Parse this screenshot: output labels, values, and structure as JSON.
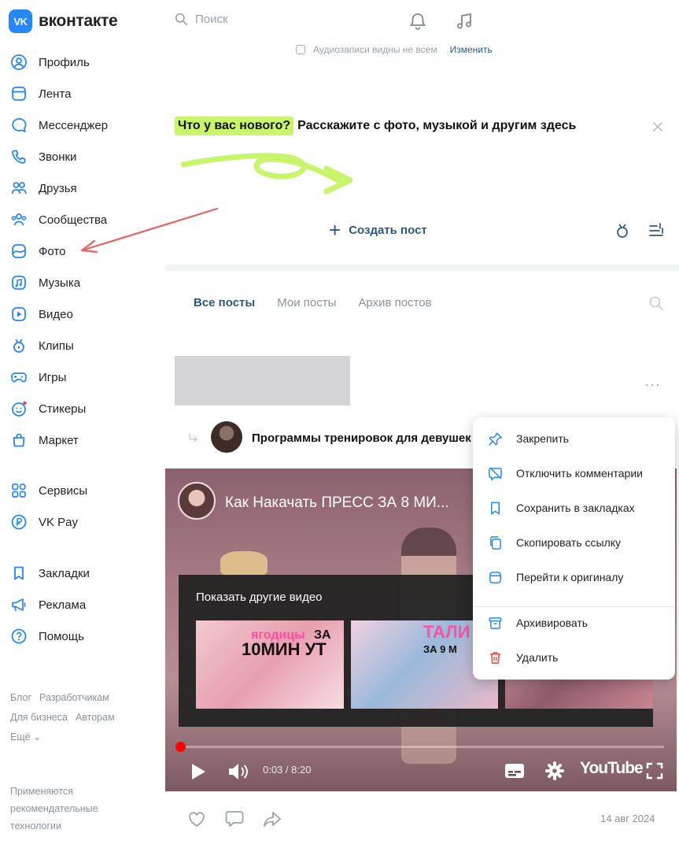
{
  "header": {
    "logo_mark": "VK",
    "logo_text": "вконтакте",
    "search_placeholder": "Поиск",
    "notifications_icon": "bell-icon",
    "music_icon": "music-note-icon"
  },
  "sidebar": {
    "items": [
      {
        "label": "Профиль",
        "icon": "profile-icon"
      },
      {
        "label": "Лента",
        "icon": "feed-icon"
      },
      {
        "label": "Мессенджер",
        "icon": "messenger-icon"
      },
      {
        "label": "Звонки",
        "icon": "phone-icon"
      },
      {
        "label": "Друзья",
        "icon": "friends-icon"
      },
      {
        "label": "Сообщества",
        "icon": "communities-icon"
      },
      {
        "label": "Фото",
        "icon": "photo-icon"
      },
      {
        "label": "Музыка",
        "icon": "music-icon"
      },
      {
        "label": "Видео",
        "icon": "video-icon"
      },
      {
        "label": "Клипы",
        "icon": "clips-icon"
      },
      {
        "label": "Игры",
        "icon": "games-icon"
      },
      {
        "label": "Стикеры",
        "icon": "stickers-icon"
      },
      {
        "label": "Маркет",
        "icon": "market-icon"
      },
      {
        "label": "Сервисы",
        "icon": "services-icon"
      },
      {
        "label": "VK Pay",
        "icon": "vk-pay-icon"
      },
      {
        "label": "Закладки",
        "icon": "bookmarks-icon"
      },
      {
        "label": "Реклама",
        "icon": "ads-icon"
      },
      {
        "label": "Помощь",
        "icon": "help-icon"
      }
    ],
    "footer_links": {
      "row1": [
        "Блог",
        "Разработчикам"
      ],
      "row2": [
        "Для бизнеса",
        "Авторам"
      ],
      "row3": [
        "Ещё ⌄"
      ]
    },
    "footer_note": "Применяются рекомендательные технологии"
  },
  "composer": {
    "hidden_notice": "Аудиозаписи видны не всем",
    "hidden_notice_action": "Изменить",
    "prompt_highlight": "Что у вас нового?",
    "prompt_rest": "Расскажите с фото, музыкой и другим здесь",
    "create_post": "Создать пост"
  },
  "tabs": {
    "all_posts": "Все посты",
    "my_posts": "Мои посты",
    "archive": "Архив постов"
  },
  "post": {
    "title": "Программы тренировок для девушек",
    "date": "14 авг 2024",
    "video": {
      "title": "Как Накачать ПРЕСС ЗА 8 МИ...",
      "overlay_title": "Показать другие видео",
      "thumb1_text_a": "ягодицы",
      "thumb1_text_b": "ЗА",
      "thumb1_text_c": "10МИН УТ",
      "thumb2_text_a": "ТАЛИ",
      "thumb2_text_b": "ЗА 9 М",
      "time": "0:03 / 8:20",
      "progress": 0.006,
      "brand": "YouTube"
    }
  },
  "context_menu": {
    "items": [
      {
        "label": "Закрепить",
        "icon": "pin-icon"
      },
      {
        "label": "Отключить комментарии",
        "icon": "comments-off-icon"
      },
      {
        "label": "Сохранить в закладках",
        "icon": "bookmark-icon"
      },
      {
        "label": "Скопировать ссылку",
        "icon": "copy-link-icon"
      },
      {
        "label": "Перейти к оригиналу",
        "icon": "original-icon"
      },
      {
        "label": "Архивировать",
        "icon": "archive-icon"
      },
      {
        "label": "Удалить",
        "icon": "trash-icon"
      }
    ]
  },
  "colors": {
    "brand": "#2787f5",
    "link": "#2a5885",
    "highlight": "#c8f56b",
    "annotation_arrow": "#e8625e",
    "delete": "#e64646"
  }
}
